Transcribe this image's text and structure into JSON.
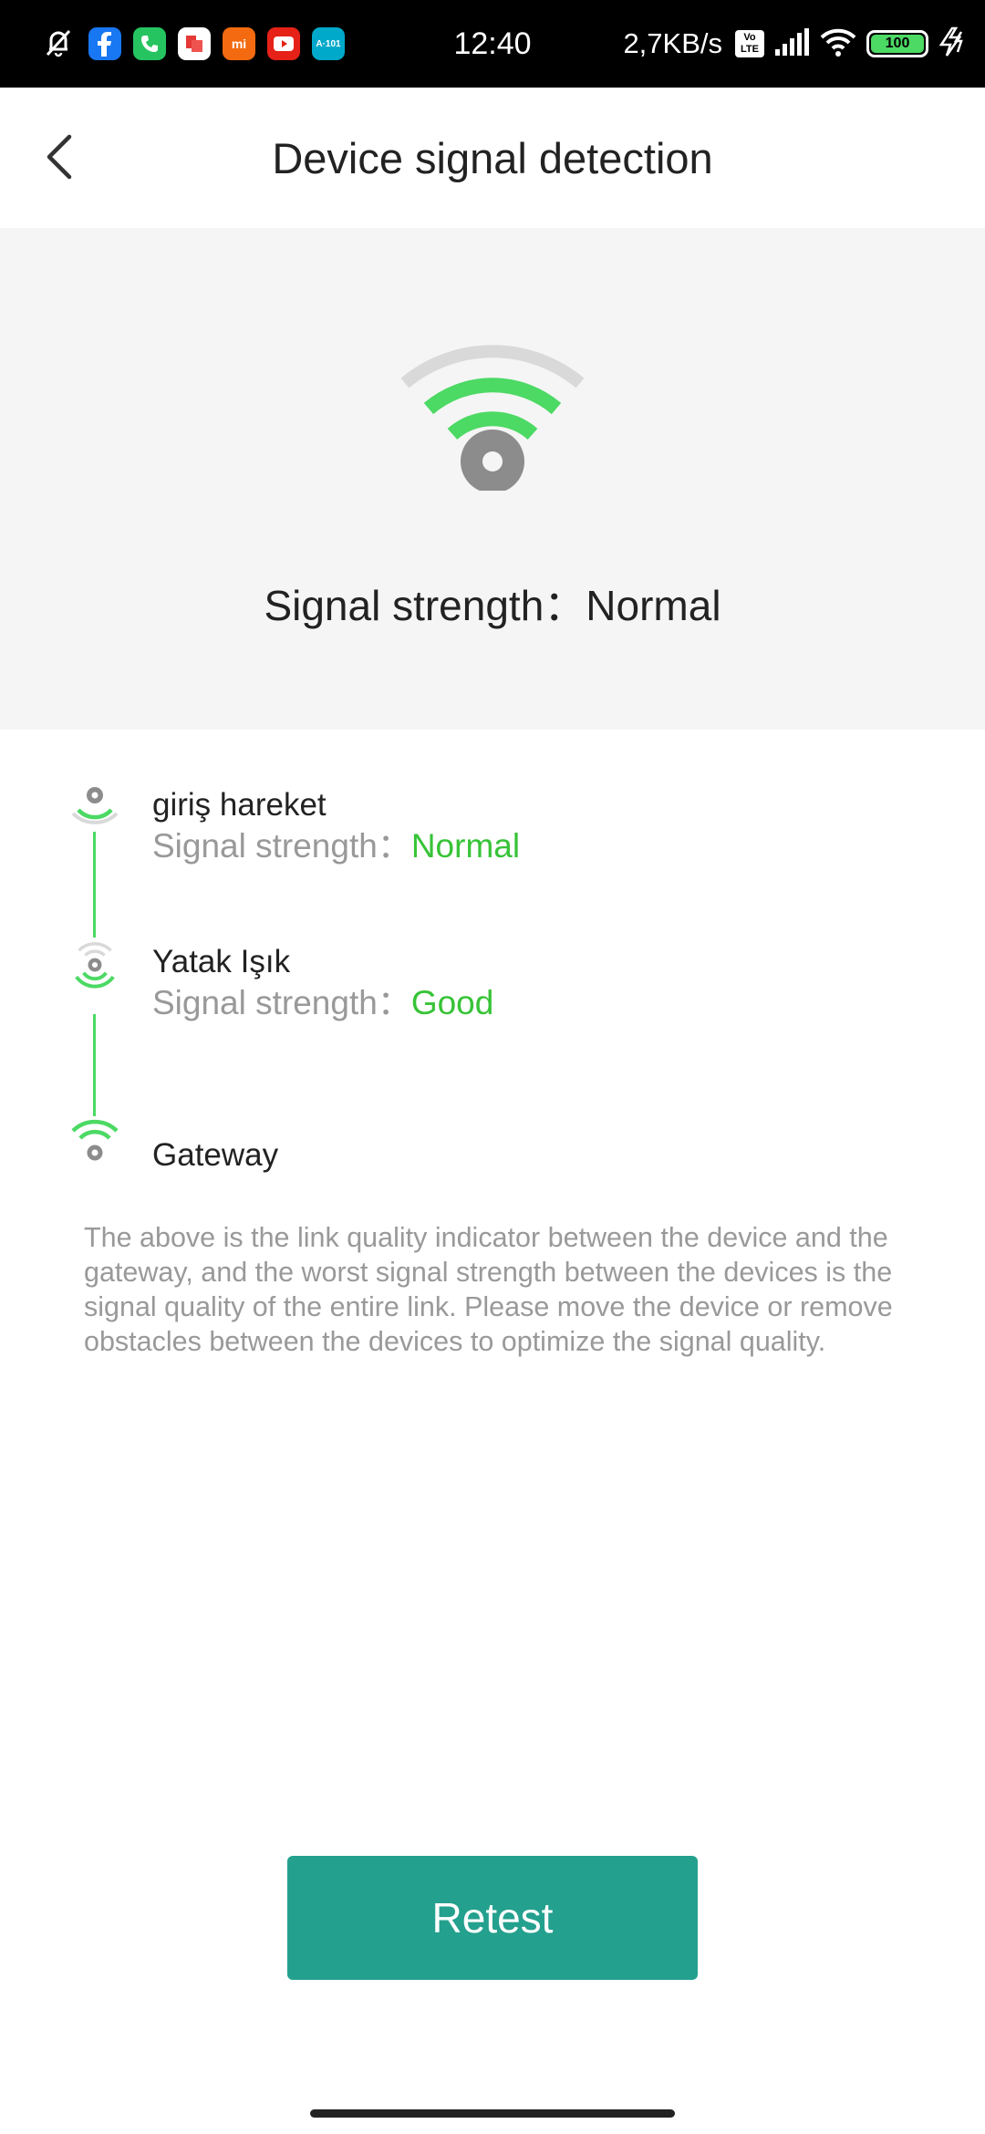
{
  "status_bar": {
    "time": "12:40",
    "network_speed": "2,7KB/s",
    "volte_label": "Vo LTE",
    "battery_level": "100",
    "app_icons": [
      "muted-bell-icon",
      "facebook-icon",
      "phone-icon",
      "office-icon",
      "mi-icon",
      "youtube-icon",
      "a101-icon"
    ],
    "mi_label": "mi",
    "a101_label": "A·101"
  },
  "header": {
    "title": "Device signal detection",
    "back_icon": "chevron-left-icon"
  },
  "hero": {
    "icon": "wifi-signal-icon",
    "label": "Signal strength：Normal"
  },
  "link_nodes": [
    {
      "name": "giriş hareket",
      "signal_label": "Signal strength：",
      "signal_value": "Normal",
      "icon": "signal-weak-icon"
    },
    {
      "name": "Yatak Işık",
      "signal_label": "Signal strength：",
      "signal_value": "Good",
      "icon": "signal-good-icon"
    },
    {
      "name": "Gateway",
      "icon": "gateway-wifi-icon"
    }
  ],
  "description": "The above is the link quality indicator between the device and the gateway, and the worst signal strength between the devices is the signal quality of the entire link. Please move the device or remove obstacles between the devices to optimize the signal quality.",
  "retest_label": "Retest",
  "colors": {
    "accent_green": "#4cd964",
    "status_green": "#37c337",
    "button_teal": "#24a08e",
    "hero_bg": "#f5f5f5",
    "muted_text": "#999999"
  }
}
